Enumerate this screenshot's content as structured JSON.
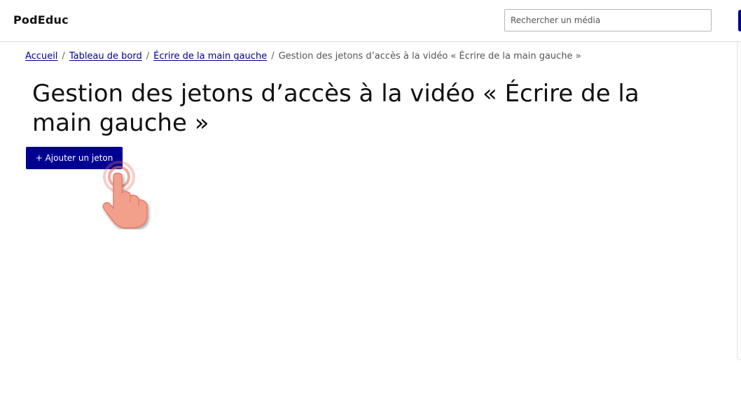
{
  "header": {
    "brand": "PodEduc",
    "search_placeholder": "Rechercher un média"
  },
  "breadcrumb": {
    "items": [
      {
        "label": "Accueil",
        "link": true
      },
      {
        "label": "Tableau de bord",
        "link": true
      },
      {
        "label": "Écrire de la main gauche",
        "link": true
      },
      {
        "label": "Gestion des jetons d’accès à la vidéo « Écrire de la main gauche »",
        "link": false
      }
    ],
    "separator": "/"
  },
  "main": {
    "title": "Gestion des jetons d’accès à la vidéo « Écrire de la main gauche »",
    "add_button_label": "+ Ajouter un jeton"
  },
  "colors": {
    "primary": "#000091",
    "cursor_skin": "#f2a08c",
    "cursor_ring": "#e8735f"
  },
  "icons": {
    "cursor": "pointing-hand-icon"
  }
}
